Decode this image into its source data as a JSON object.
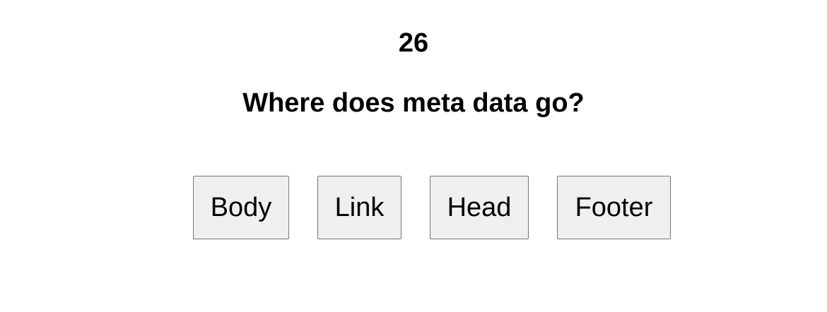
{
  "quiz": {
    "score": "26",
    "question": "Where does meta data go?",
    "answers": [
      {
        "label": "Body"
      },
      {
        "label": "Link"
      },
      {
        "label": "Head"
      },
      {
        "label": "Footer"
      }
    ]
  },
  "colors": {
    "background": "#ffffff",
    "button_background": "#efefef",
    "button_border": "#767676",
    "text": "#000000"
  }
}
